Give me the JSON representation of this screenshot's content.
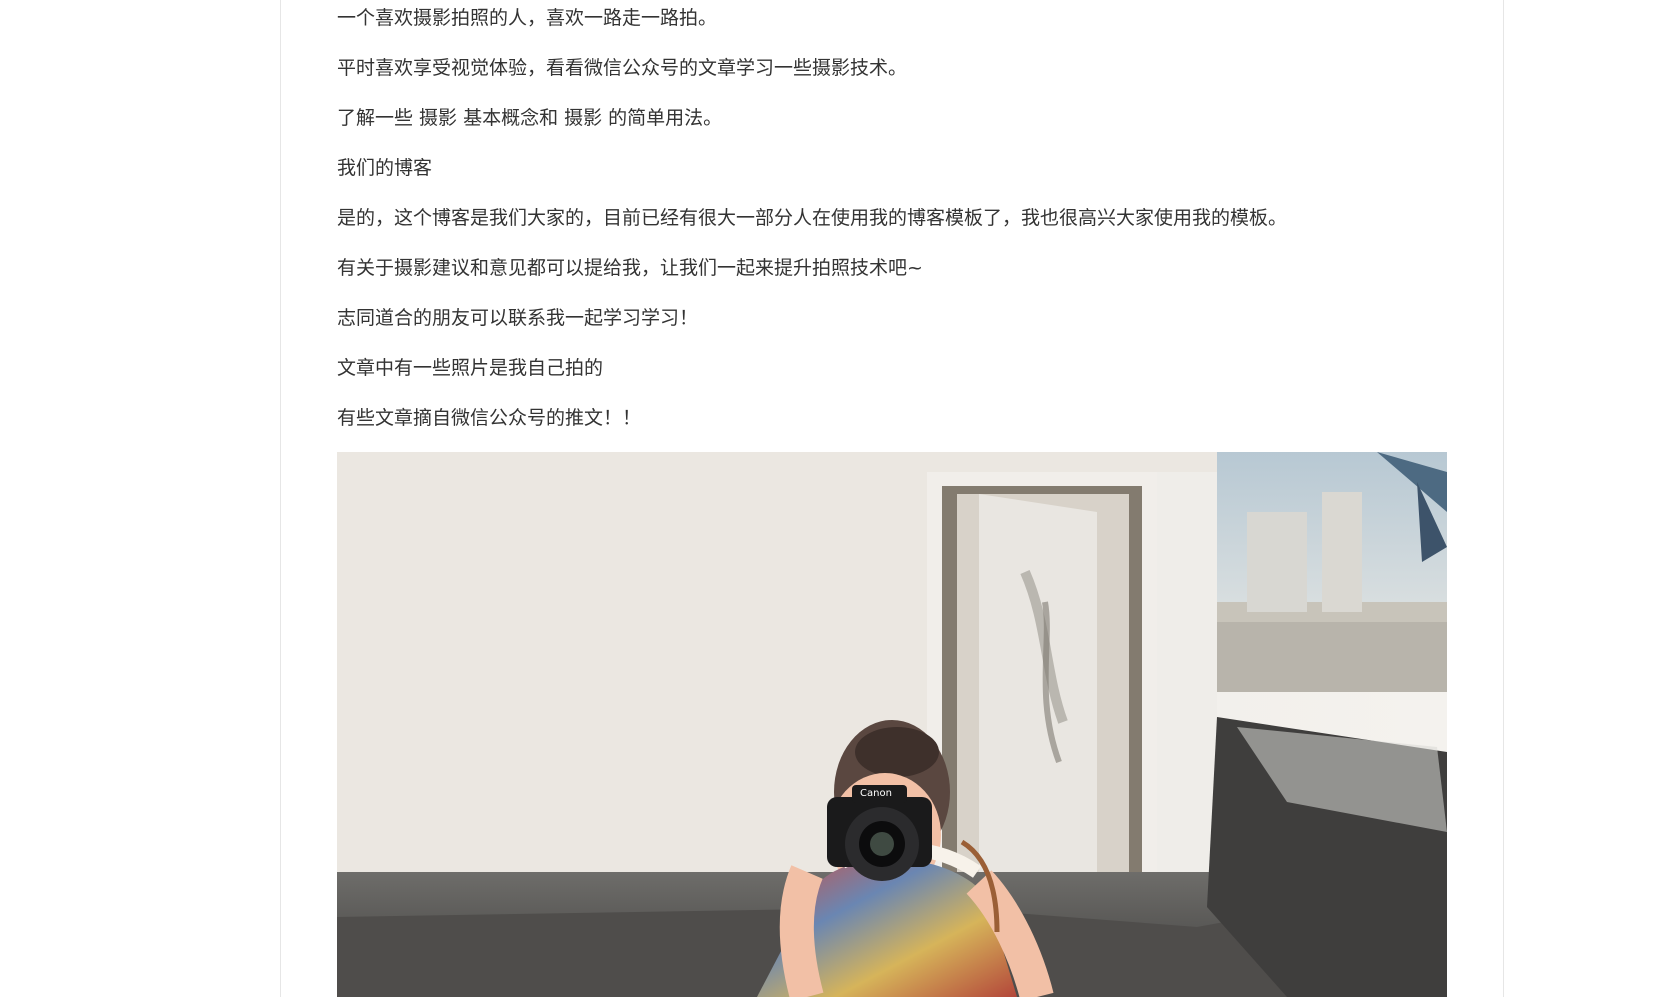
{
  "article": {
    "paragraphs": [
      "一个喜欢摄影拍照的人，喜欢一路走一路拍。",
      "平时喜欢享受视觉体验，看看微信公众号的文章学习一些摄影技术。",
      "了解一些 摄影 基本概念和 摄影 的简单用法。",
      "我们的博客",
      "是的，这个博客是我们大家的，目前已经有很大一部分人在使用我的博客模板了，我也很高兴大家使用我的模板。",
      "有关于摄影建议和意见都可以提给我，让我们一起来提升拍照技术吧~",
      "志同道合的朋友可以联系我一起学习学习！",
      "文章中有一些照片是我自己拍的",
      "有些文章摘自微信公众号的推文！！"
    ]
  },
  "photo": {
    "camera_brand": "Canon"
  },
  "colors": {
    "text": "#333333",
    "card_border": "#e6e6e6",
    "page_background": "#ffffff"
  }
}
